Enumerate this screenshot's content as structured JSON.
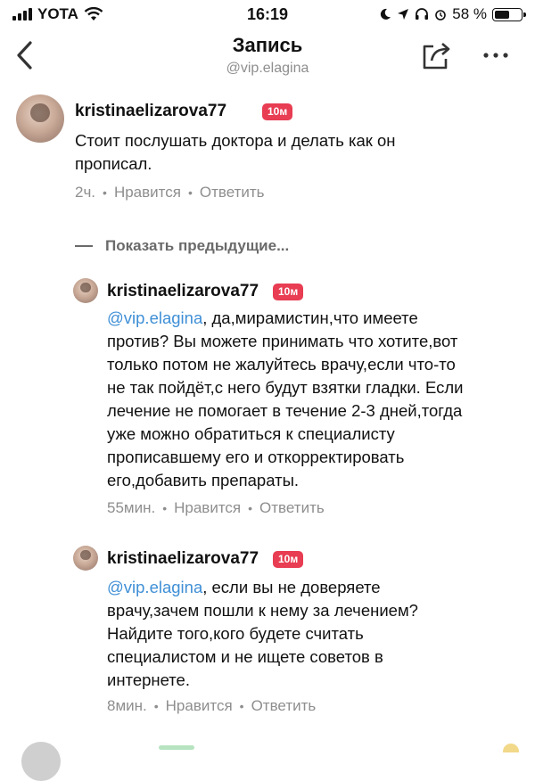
{
  "status_bar": {
    "carrier": "YOTA",
    "time": "16:19",
    "battery_percent": "58 %",
    "battery_level": 0.58
  },
  "nav": {
    "title": "Запись",
    "subtitle": "@vip.elagina",
    "icons": [
      "back-chevron",
      "share",
      "more-dots"
    ]
  },
  "main_comment": {
    "username": "kristinaelizarova77",
    "badge": "10м",
    "text": "Стоит послушать доктора и делать как он прописал.",
    "text_lines": [
      "Стоит послушать доктора и делать как он",
      "прописал."
    ],
    "time": "2ч.",
    "like": "Нравится",
    "reply": "Ответить"
  },
  "show_previous": "Показать предыдущие...",
  "replies": [
    {
      "username": "kristinaelizarova77",
      "badge": "10м",
      "mention": "@vip.elagina",
      "lines": [
        ", да,мирамистин,что имеете",
        "против? Вы можете принимать что хотите,вот",
        "только потом не жалуйтесь врачу,если что-то",
        "не так пойдёт,с него будут взятки гладки. Если",
        "лечение не помогает в течение 2-3 дней,тогда",
        "уже можно обратиться к специалисту",
        "прописавшему его и откорректировать",
        "его,добавить препараты."
      ],
      "time": "55мин.",
      "like": "Нравится",
      "reply": "Ответить"
    },
    {
      "username": "kristinaelizarova77",
      "badge": "10м",
      "mention": "@vip.elagina",
      "lines": [
        ", если вы не доверяете",
        "врачу,зачем пошли к нему за лечением?",
        "Найдите того,кого будете считать",
        "специалистом и не ищете советов в",
        "интернете."
      ],
      "time": "8мин.",
      "like": "Нравится",
      "reply": "Ответить"
    }
  ],
  "colors": {
    "badge": "#e83d52",
    "mention": "#3f8fd6",
    "meta": "#8e8e8e"
  }
}
